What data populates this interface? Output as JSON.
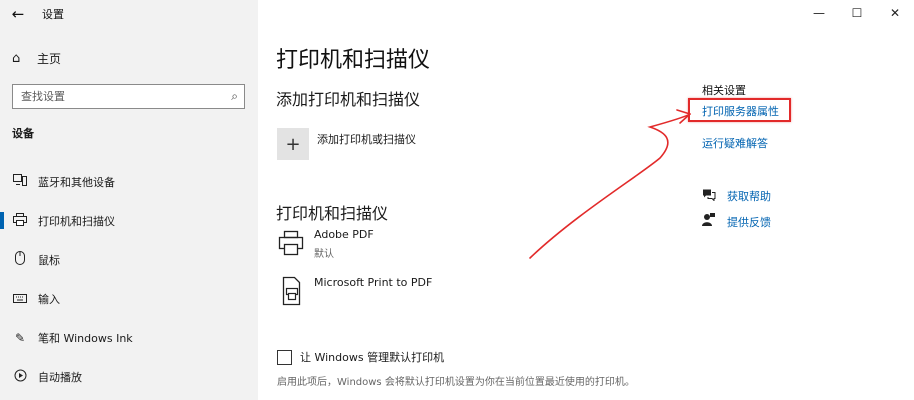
{
  "window": {
    "title": "设置",
    "back_icon": "←",
    "controls": {
      "minimize": "—",
      "maximize": "☐",
      "close": "✕"
    }
  },
  "sidebar": {
    "home_label": "主页",
    "search_placeholder": "查找设置",
    "section_label": "设备",
    "items": [
      {
        "label": "蓝牙和其他设备",
        "icon": "bluetooth-devices-icon",
        "active": false
      },
      {
        "label": "打印机和扫描仪",
        "icon": "printer-icon",
        "active": true
      },
      {
        "label": "鼠标",
        "icon": "mouse-icon",
        "active": false
      },
      {
        "label": "输入",
        "icon": "keyboard-icon",
        "active": false
      },
      {
        "label": "笔和 Windows Ink",
        "icon": "pen-icon",
        "active": false
      },
      {
        "label": "自动播放",
        "icon": "autoplay-icon",
        "active": false
      }
    ]
  },
  "main": {
    "title": "打印机和扫描仪",
    "add_section_title": "添加打印机和扫描仪",
    "add_button_label": "添加打印机或扫描仪",
    "printers_section_title": "打印机和扫描仪",
    "printers": [
      {
        "name": "Adobe PDF",
        "status": "默认"
      },
      {
        "name": "Microsoft Print to PDF",
        "status": ""
      }
    ],
    "checkbox_label": "让 Windows 管理默认打印机",
    "checkbox_checked": false,
    "description": "启用此项后，Windows 会将默认打印机设置为你在当前位置最近使用的打印机。"
  },
  "related": {
    "title": "相关设置",
    "links": [
      "打印服务器属性",
      "运行疑难解答"
    ],
    "help": [
      {
        "label": "获取帮助",
        "icon": "help-chat-icon"
      },
      {
        "label": "提供反馈",
        "icon": "feedback-icon"
      }
    ]
  },
  "annotation": {
    "highlight_color": "#e22a2a"
  },
  "colors": {
    "accent": "#0063b1",
    "sidebar_bg": "#f2f2f2"
  }
}
